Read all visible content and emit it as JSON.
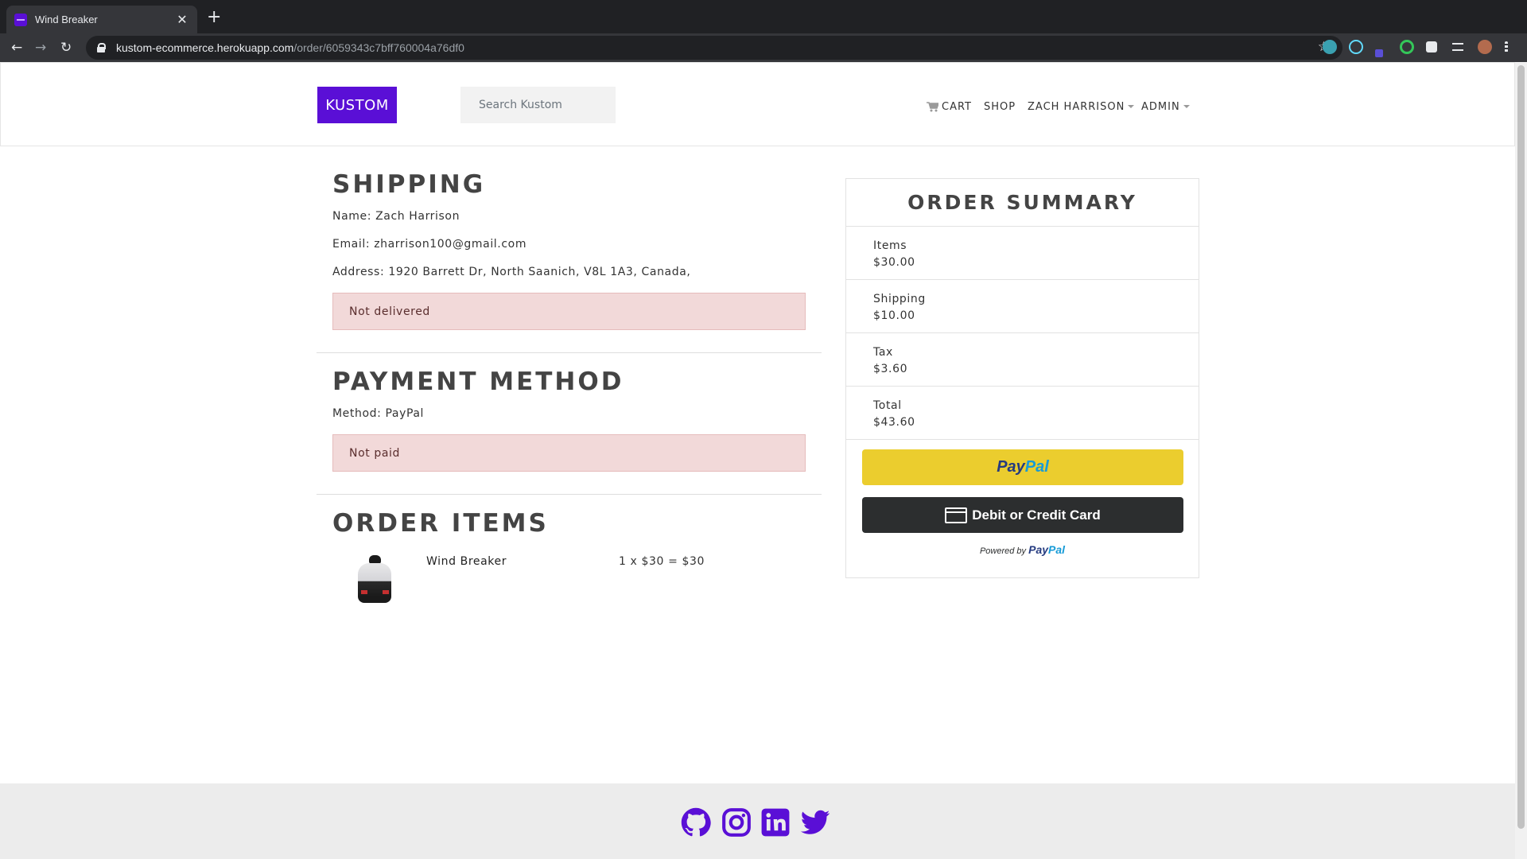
{
  "browser": {
    "tab_title": "Wind Breaker",
    "tab_close": "✕",
    "new_tab": "+",
    "url_host": "kustom-ecommerce.herokuapp.com",
    "url_path": "/order/6059343c7bff760004a76df0",
    "back": "←",
    "forward": "→",
    "reload": "↻",
    "star": "☆"
  },
  "header": {
    "brand": "KUSTOM",
    "search_placeholder": "Search Kustom",
    "nav": {
      "cart": "CART",
      "shop": "SHOP",
      "user": "ZACH HARRISON",
      "admin": "ADMIN"
    }
  },
  "shipping": {
    "heading": "SHIPPING",
    "name": "Name: Zach Harrison",
    "email": "Email: zharrison100@gmail.com",
    "address": "Address: 1920 Barrett Dr, North Saanich, V8L 1A3, Canada,",
    "status": "Not delivered"
  },
  "payment": {
    "heading": "PAYMENT METHOD",
    "method": "Method: PayPal",
    "status": "Not paid"
  },
  "order_items": {
    "heading": "ORDER ITEMS",
    "items": [
      {
        "name": "Wind Breaker",
        "price_line": "1 x $30 = $30"
      }
    ]
  },
  "summary": {
    "heading": "ORDER SUMMARY",
    "rows": [
      {
        "label": "Items",
        "value": "$30.00"
      },
      {
        "label": "Shipping",
        "value": "$10.00"
      },
      {
        "label": "Tax",
        "value": "$3.60"
      },
      {
        "label": "Total",
        "value": "$43.60"
      }
    ],
    "paypal_pay": "Pay",
    "paypal_pal": "Pal",
    "card_button": "Debit or Credit Card",
    "powered_by": "Powered by",
    "powered_pay": "Pay",
    "powered_pal": "Pal"
  },
  "colors": {
    "brand": "#5a0fd6",
    "alert_bg": "#f2d9d9",
    "paypal_yellow": "#ebcd2e",
    "card_black": "#2c2e2f"
  },
  "footer": {
    "icons": [
      "github-icon",
      "instagram-icon",
      "linkedin-icon",
      "twitter-icon"
    ]
  }
}
